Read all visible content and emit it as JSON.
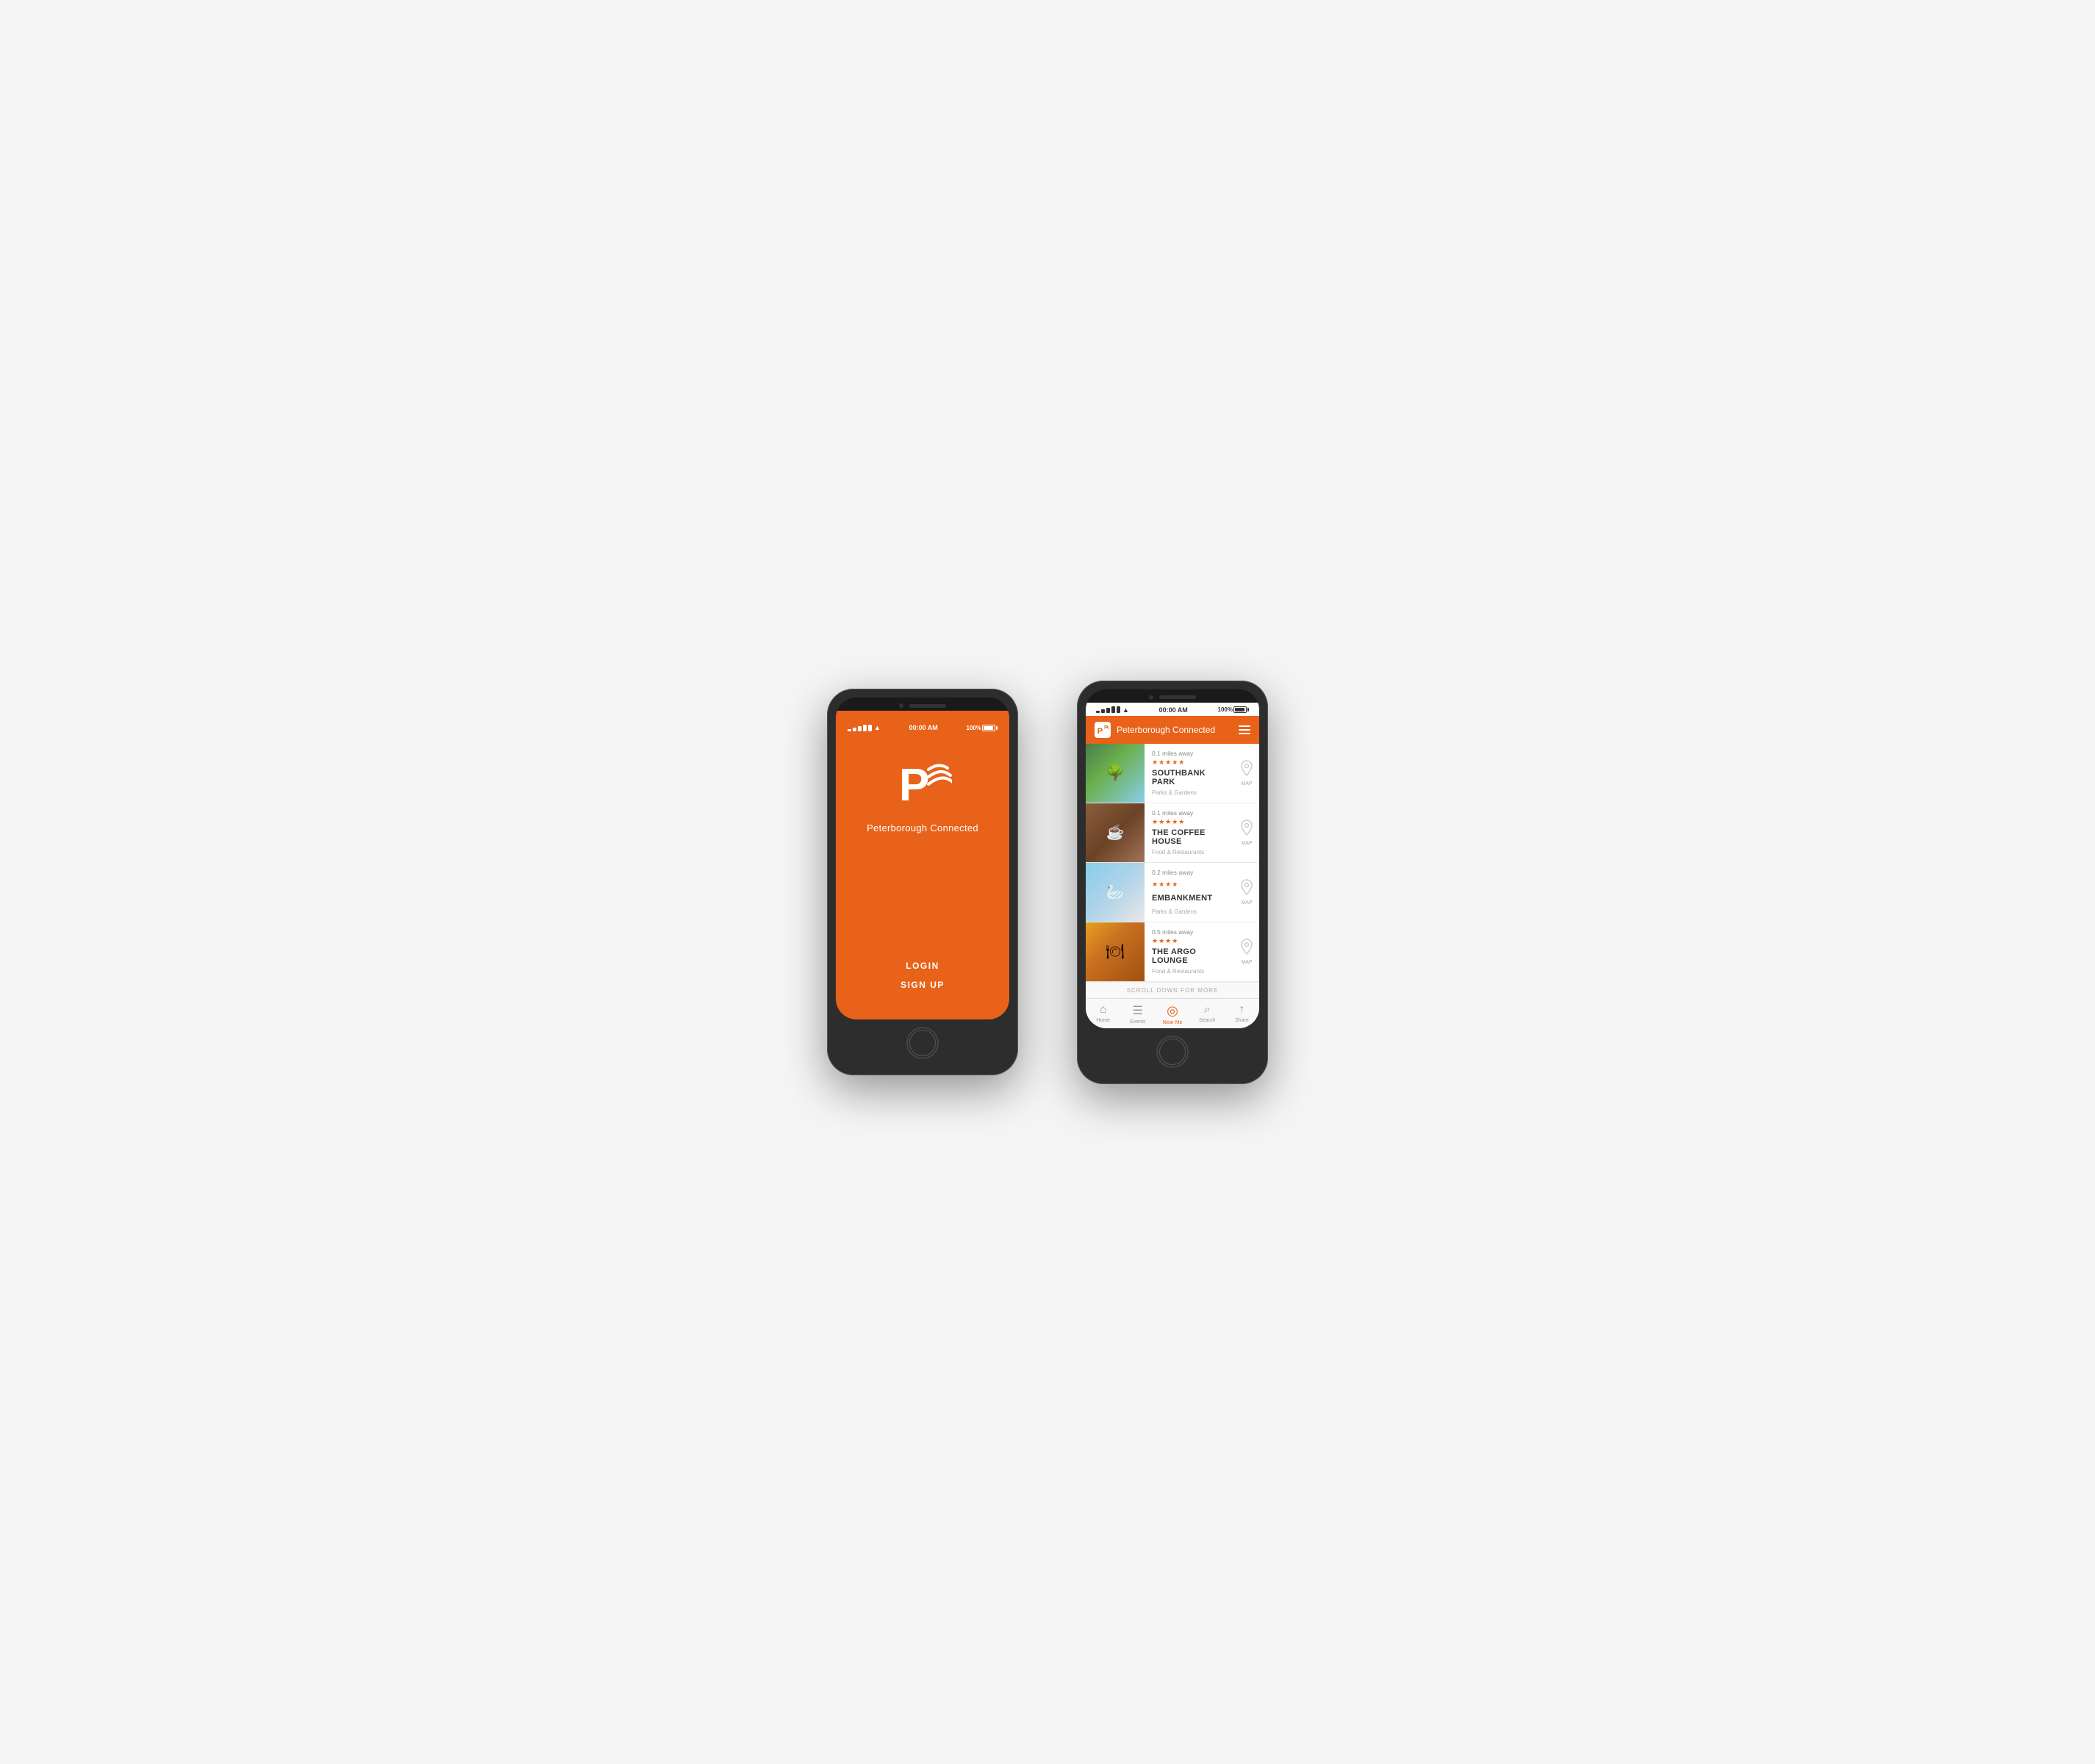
{
  "phone1": {
    "status": {
      "time": "00:00 AM",
      "battery": "100%"
    },
    "screen": {
      "bg_color": "#e8621a",
      "app_name": "Peterborough Connected",
      "login_label": "LOGIN",
      "signup_label": "SIGN UP"
    }
  },
  "phone2": {
    "status": {
      "time": "00:00 AM",
      "battery": "100%"
    },
    "header": {
      "title": "Peterborough Connected",
      "menu_icon": "hamburger"
    },
    "locations": [
      {
        "distance": "0.1 miles away",
        "stars": "★★★★★",
        "name": "SOUTHBANK PARK",
        "category": "Parks & Gardens",
        "map_label": "MAP",
        "thumb_class": "thumb-park1"
      },
      {
        "distance": "0.1 miles away",
        "stars": "★★★★★",
        "name": "THE COFFEE HOUSE",
        "category": "Food & Restaurants",
        "map_label": "MAP",
        "thumb_class": "thumb-cafe"
      },
      {
        "distance": "0.2 miles away",
        "stars": "★★★★",
        "name": "EMBANKMENT",
        "category": "Parks & Gardens",
        "map_label": "MAP",
        "thumb_class": "thumb-embankment"
      },
      {
        "distance": "0.5 miles away",
        "stars": "★★★★",
        "name": "THE ARGO LOUNGE",
        "category": "Food & Restaurants",
        "map_label": "MAP",
        "thumb_class": "thumb-argo"
      }
    ],
    "scroll_more": "SCROLL DOWN FOR MORE",
    "nav": [
      {
        "label": "Home",
        "icon": "🏠",
        "active": false
      },
      {
        "label": "Events",
        "icon": "📅",
        "active": false
      },
      {
        "label": "Near Me",
        "icon": "◎",
        "active": true
      },
      {
        "label": "Search",
        "icon": "🔍",
        "active": false
      },
      {
        "label": "Share",
        "icon": "⬆",
        "active": false
      }
    ]
  }
}
